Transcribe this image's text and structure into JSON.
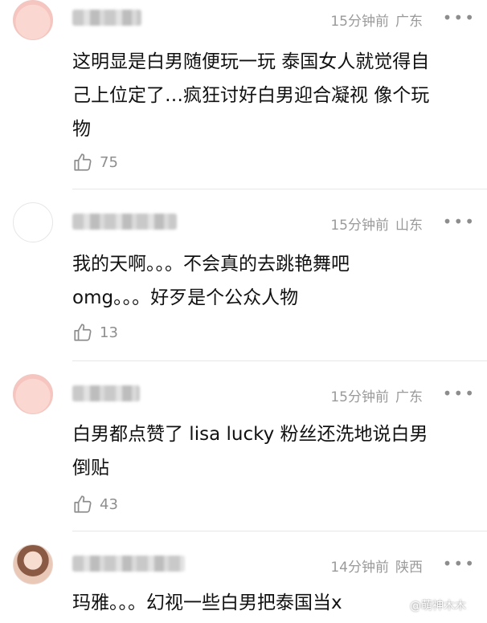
{
  "comments": [
    {
      "time": "15分钟前",
      "location": "广东",
      "text_lines": [
        "这明显是白男随便玩一玩 泰国女人就觉得自",
        "己上位定了…疯狂讨好白男迎合凝视 像个玩",
        "物"
      ],
      "likes": "75"
    },
    {
      "time": "15分钟前",
      "location": "山东",
      "text_lines": [
        "我的天啊。。。不会真的去跳艳舞吧",
        "omg。。。好歹是个公众人物"
      ],
      "likes": "13"
    },
    {
      "time": "15分钟前",
      "location": "广东",
      "text_lines": [
        "白男都点赞了 lisa lucky 粉丝还洗地说白男",
        "倒贴"
      ],
      "likes": "43"
    },
    {
      "time": "14分钟前",
      "location": "陕西",
      "text_lines": [
        "玛雅。。。幻视一些白男把泰国当x"
      ],
      "likes": ""
    }
  ],
  "watermark": "@萌神木木",
  "icons": {
    "more": "more-dots-icon",
    "like": "thumbs-up-icon"
  },
  "colors": {
    "meta": "#9a9a9a",
    "text": "#111111"
  }
}
